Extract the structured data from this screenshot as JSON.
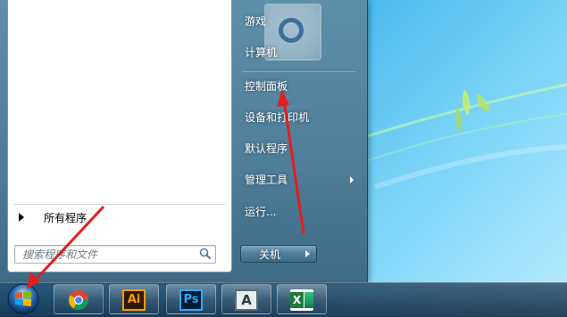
{
  "start_menu": {
    "all_programs_label": "所有程序",
    "search_placeholder": "搜索程序和文件",
    "right_items": [
      {
        "label": "游戏"
      },
      {
        "label": "计算机"
      },
      {
        "label": "控制面板"
      },
      {
        "label": "设备和打印机"
      },
      {
        "label": "默认程序"
      },
      {
        "label": "管理工具"
      },
      {
        "label": "运行..."
      }
    ],
    "shutdown_label": "关机"
  },
  "taskbar": {
    "apps": [
      {
        "name": "chrome-icon"
      },
      {
        "name": "illustrator-icon",
        "label": "Ai"
      },
      {
        "name": "photoshop-icon",
        "label": "Ps"
      },
      {
        "name": "autocad-icon",
        "label": "A"
      },
      {
        "name": "excel-icon",
        "label": "X"
      }
    ]
  },
  "colors": {
    "annotation_red": "#e02020",
    "start_menu_bg": "#4e7d98",
    "illustrator_orange": "#ff9a00",
    "photoshop_blue": "#31a8ff",
    "excel_green": "#1f7a42"
  }
}
